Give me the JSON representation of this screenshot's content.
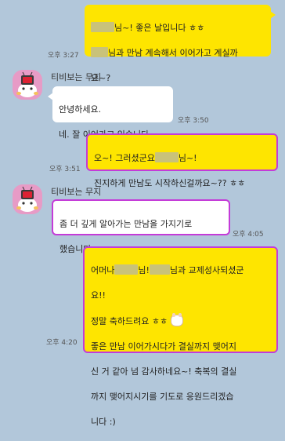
{
  "colors": {
    "background": "#b2c7da",
    "my_bubble": "#fee500",
    "their_bubble": "#ffffff",
    "highlight_border": "#c43bd8",
    "redaction": "#c9c27a",
    "avatar_bg": "#e79bc6"
  },
  "messages": [
    {
      "sender": "me",
      "lines": [
        "님~! 좋은 날입니다 ㅎㅎ",
        "님과 만남 계속해서 이어가고 계실까",
        "요~?"
      ],
      "time": "오후 3:27"
    },
    {
      "sender": "other",
      "name": "티비보는 무지",
      "avatar_icon": "tv-robot-avatar-icon",
      "lines": [
        "안녕하세요.",
        "네. 잘 이어가고 있습니다."
      ],
      "time": "오후 3:50"
    },
    {
      "sender": "me",
      "lines": [
        "오~! 그러셨군요",
        "님~!",
        "진지하게 만남도 시작하신걸까요~?? ㅎㅎ"
      ],
      "time": "오후 3:51"
    },
    {
      "sender": "other",
      "name": "티비보는 무지",
      "avatar_icon": "tv-robot-avatar-icon",
      "lines": [
        "좀 더 깊게 알아가는 만남을 가지기로",
        "했습니다."
      ],
      "time": "오후 4:05"
    },
    {
      "sender": "me",
      "lines": [
        "어머나",
        "님!",
        "님과 교제성사되셨군",
        "요!!",
        "정말 축하드려요 ㅎㅎ",
        "좋은 만남 이어가시다가 결실까지 맺어지",
        "신 거 같아 넘 감사하네요~! 축복의 결실",
        "까지 맺어지시기를 기도로 응원드리겠습",
        "니다 :)"
      ],
      "emoji_icon": "puppy-emoji-icon",
      "time": "오후 4:20"
    }
  ]
}
